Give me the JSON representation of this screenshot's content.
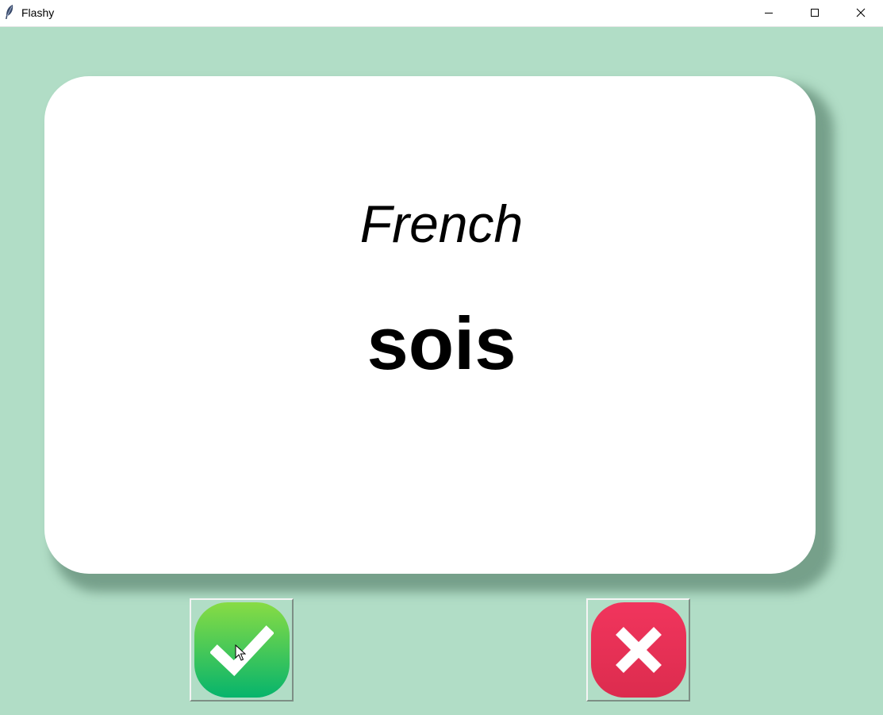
{
  "window": {
    "title": "Flashy",
    "icon": "feather-icon",
    "controls": [
      "minimize-icon",
      "maximize-icon",
      "close-icon"
    ]
  },
  "colors": {
    "background": "#b1ddc6",
    "card": "#ffffff",
    "right_button": "#2ecc5a",
    "wrong_button": "#e83155"
  },
  "card": {
    "title": "French",
    "word": "sois"
  },
  "buttons": {
    "right": {
      "icon": "checkmark-icon"
    },
    "wrong": {
      "icon": "x-icon"
    }
  }
}
